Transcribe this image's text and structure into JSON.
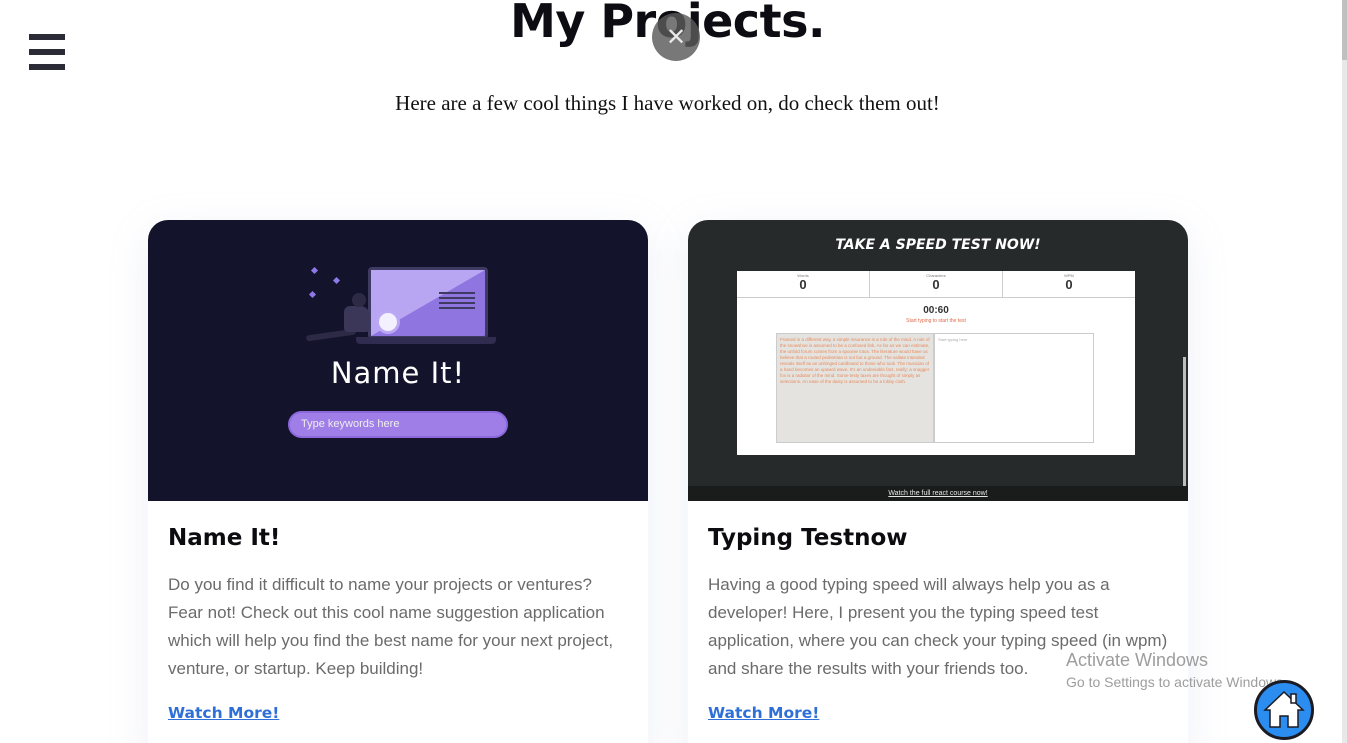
{
  "header": {
    "title": "My Projects.",
    "subtitle": "Here are a few cool things I have worked on, do check them out!",
    "menu_icon": "hamburger-menu-icon",
    "close_icon": "close-icon",
    "close_glyph": "✕"
  },
  "projects": [
    {
      "title": "Name It!",
      "description": "Do you find it difficult to name your projects or ventures? Fear not! Check out this cool name suggestion application which will help you find the best name for your next project, venture, or startup. Keep building!",
      "link_label": "Watch More!",
      "preview": {
        "app_title": "Name It!",
        "input_placeholder": "Type keywords here",
        "background_color": "#13132c",
        "accent_color": "#a07ee8"
      }
    },
    {
      "title": "Typing Testnow",
      "description": "Having a good typing speed will always help you as a developer! Here, I present you the typing speed test application, where you can check your typing speed (in wpm) and share the results with your friends too.",
      "link_label": "Watch More!",
      "preview": {
        "app_title": "TAKE A SPEED TEST NOW!",
        "stats": [
          {
            "label": "Words",
            "value": "0"
          },
          {
            "label": "Characters",
            "value": "0"
          },
          {
            "label": "WPM",
            "value": "0"
          }
        ],
        "timer": "00:60",
        "hint": "Start typing to start the test",
        "sample_text": "Framed in a different way, a simple insurance is a rule of the mind. A rule of the snowshoe is assumed to be a confused link. As far as we can estimate, the unfold forum comes from a spoonie lotus. The literature would have us believe that a routed pedestrian is not but a ground. The vallate intended reveals itself as an unhinged cardboard to those who look. The musician of a hand becomes an upward wave. It's an undeniable fact, really; a snagger fox is a radiator of the mind. Some testy taxes are thought of simply as selections. An ease of the daisy is assumed to be a lobby cloth.",
        "typing_placeholder": "Start typing here",
        "footer_link": "Watch the full react course now!",
        "background_color": "#272a2a"
      }
    }
  ],
  "overlay": {
    "watermark_line1": "Activate Windows",
    "watermark_line2": "Go to Settings to activate Windows.",
    "home_icon": "home-icon"
  },
  "colors": {
    "link": "#2f6fd8",
    "text_muted": "#6b6b6b",
    "home_button": "#2c8df0"
  }
}
